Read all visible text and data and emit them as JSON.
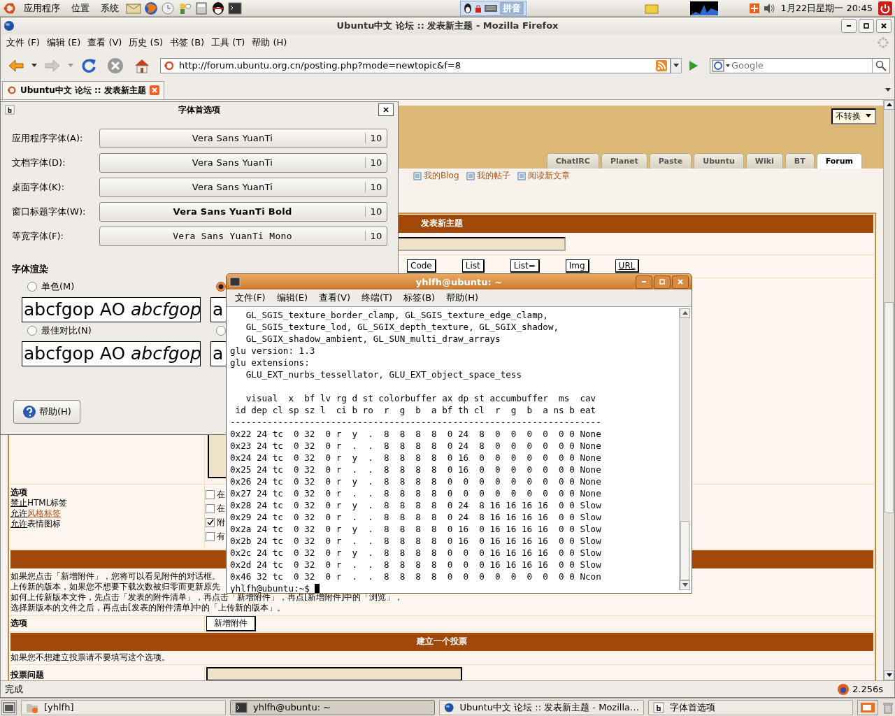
{
  "top_panel": {
    "menus": [
      "应用程序",
      "位置",
      "系统"
    ],
    "input_method": "拼音",
    "clock": "1月22日星期一 20:45"
  },
  "browser": {
    "title": "Ubuntu中文 论坛 :: 发表新主题 - Mozilla Firefox",
    "menus": [
      "文件 (F)",
      "编辑 (E)",
      "查看 (V)",
      "历史 (S)",
      "书签 (B)",
      "工具 (T)",
      "帮助 (H)"
    ],
    "url": "http://forum.ubuntu.org.cn/posting.php?mode=newtopic&f=8",
    "search": {
      "placeholder": "Google"
    },
    "tabs": [
      {
        "label": "Ubuntu中文 论坛 :: 发表新主题",
        "selected": true
      }
    ],
    "status": "完成",
    "timing": "2.256s"
  },
  "page": {
    "convert_select": "不转换",
    "site_tabs": [
      {
        "label": "ChatIRC",
        "selected": false
      },
      {
        "label": "Planet",
        "selected": false
      },
      {
        "label": "Paste",
        "selected": false
      },
      {
        "label": "Ubuntu",
        "selected": false
      },
      {
        "label": "Wiki",
        "selected": false
      },
      {
        "label": "BT",
        "selected": false
      },
      {
        "label": "Forum",
        "selected": true
      }
    ],
    "user_links": [
      "我的Blog",
      "我的帖子",
      "阅读新文章"
    ],
    "post_header": "发表新主题",
    "bbcode_buttons": [
      "Code",
      "List",
      "List=",
      "Img",
      "URL"
    ],
    "options_title": "选项",
    "option_lines": [
      {
        "link": "禁止",
        "text": "HTML标签",
        "text_is_link": false
      },
      {
        "link": "允许",
        "text": "风格标签",
        "text_is_link": true
      },
      {
        "link": "允许",
        "text": "表情图标",
        "text_is_link": false
      }
    ],
    "option_checks": [
      {
        "label": "在",
        "checked": false
      },
      {
        "label": "在",
        "checked": false
      },
      {
        "label": "附",
        "checked": true
      },
      {
        "label": "有",
        "checked": false
      }
    ],
    "attach_help": [
      "如果您点击「新增附件」，您将可以看见附件的对话框。",
      "上传新的版本，如果您不想要下载次数被归零而更新原先",
      "如何上传新版本文件，先点击「发表的附件清单」，再点击「新增附件」，再点[新增附件]中的「浏览」，",
      "选择新版本的文件之后，再点击[发表的附件清单]中的「上传新的版本」。"
    ],
    "attach_label": "选项",
    "attach_button": "新增附件",
    "poll_header": "建立一个投票",
    "poll_note": "如果您不想建立投票请不要填写这个选项。",
    "poll_question": "投票问题"
  },
  "font_dialog": {
    "title": "字体首选项",
    "fonts": [
      {
        "label": "应用程序字体(A):",
        "font": "Vera Sans YuanTi",
        "size": "10"
      },
      {
        "label": "文档字体(D):",
        "font": "Vera Sans YuanTi",
        "size": "10"
      },
      {
        "label": "桌面字体(K):",
        "font": "Vera Sans YuanTi",
        "size": "10"
      },
      {
        "label": "窗口标题字体(W):",
        "font": "Vera Sans YuanTi Bold",
        "size": "10"
      },
      {
        "label": "等宽字体(F):",
        "font": "Vera Sans  YuanTi  Mono",
        "size": "10"
      }
    ],
    "rendering_title": "字体渲染",
    "options": [
      {
        "label": "单色(M)",
        "selected": false,
        "sample": "abcfgop AO ",
        "sample_italic": "abcfgop"
      },
      {
        "selected": true,
        "sample": "a"
      },
      {
        "label": "最佳对比(N)",
        "selected": false,
        "sample": "abcfgop AO ",
        "sample_italic": "abcfgop"
      },
      {
        "selected": false,
        "sample": "a"
      }
    ],
    "help_button": "帮助(H)"
  },
  "terminal": {
    "title": "yhlfh@ubuntu: ~",
    "menus": [
      "文件(F)",
      "编辑(E)",
      "查看(V)",
      "终端(T)",
      "标签(B)",
      "帮助(H)"
    ],
    "blocks": [
      [
        "   GL_SGIS_texture_border_clamp, GL_SGIS_texture_edge_clamp,",
        "   GL_SGIS_texture_lod, GL_SGIX_depth_texture, GL_SGIX_shadow,",
        "   GL_SGIX_shadow_ambient, GL_SUN_multi_draw_arrays",
        "glu version: 1.3",
        "glu extensions:",
        "   GLU_EXT_nurbs_tessellator, GLU_EXT_object_space_tess"
      ],
      [
        "   visual  x  bf lv rg d st colorbuffer ax dp st accumbuffer  ms  cav",
        " id dep cl sp sz l  ci b ro  r  g  b  a bf th cl  r  g  b  a ns b eat",
        "----------------------------------------------------------------------",
        "0x22 24 tc  0 32  0 r  y  .  8  8  8  8  0 24  8  0  0  0  0  0 0 None",
        "0x23 24 tc  0 32  0 r  .  .  8  8  8  8  0 24  8  0  0  0  0  0 0 None",
        "0x24 24 tc  0 32  0 r  y  .  8  8  8  8  0 16  0  0  0  0  0  0 0 None",
        "0x25 24 tc  0 32  0 r  .  .  8  8  8  8  0 16  0  0  0  0  0  0 0 None",
        "0x26 24 tc  0 32  0 r  y  .  8  8  8  8  0  0  0  0  0  0  0  0 0 None",
        "0x27 24 tc  0 32  0 r  .  .  8  8  8  8  0  0  0  0  0  0  0  0 0 None",
        "0x28 24 tc  0 32  0 r  y  .  8  8  8  8  0 24  8 16 16 16 16  0 0 Slow",
        "0x29 24 tc  0 32  0 r  .  .  8  8  8  8  0 24  8 16 16 16 16  0 0 Slow",
        "0x2a 24 tc  0 32  0 r  y  .  8  8  8  8  0 16  0 16 16 16 16  0 0 Slow",
        "0x2b 24 tc  0 32  0 r  .  .  8  8  8  8  0 16  0 16 16 16 16  0 0 Slow",
        "0x2c 24 tc  0 32  0 r  y  .  8  8  8  8  0  0  0 16 16 16 16  0 0 Slow",
        "0x2d 24 tc  0 32  0 r  .  .  8  8  8  8  0  0  0 16 16 16 16  0 0 Slow",
        "0x46 32 tc  0 32  0 r  .  .  8  8  8  8  0  0  0  0  0  0  0  0 0 Ncon"
      ]
    ],
    "prompt": "yhlfh@ubuntu:~$ "
  },
  "taskbar": {
    "items": [
      {
        "label": "[yhlfh]",
        "kind": "folder",
        "selected": false
      },
      {
        "label": "yhlfh@ubuntu: ~",
        "kind": "terminal",
        "selected": true
      },
      {
        "label": "Ubuntu中文 论坛 :: 发表新主题 - Mozilla…",
        "kind": "browser",
        "selected": false
      },
      {
        "label": "字体首选项",
        "kind": "font",
        "selected": false
      }
    ]
  }
}
